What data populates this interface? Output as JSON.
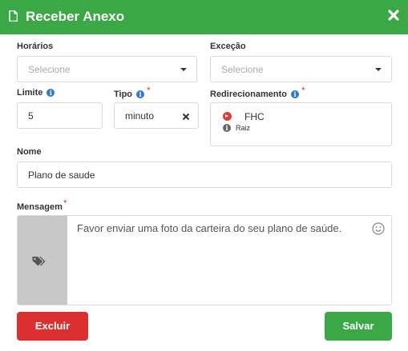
{
  "header": {
    "title": "Receber Anexo"
  },
  "fields": {
    "horarios": {
      "label": "Horários",
      "placeholder": "Selecione"
    },
    "excecao": {
      "label": "Exceção",
      "placeholder": "Selecione"
    },
    "limite": {
      "label": "Limite",
      "value": "5"
    },
    "tipo": {
      "label": "Tipo",
      "required": "*",
      "value": "minuto"
    },
    "redirecionamento": {
      "label": "Redirecionamento",
      "required": "*",
      "target": "FHC",
      "path": "Raiz"
    },
    "nome": {
      "label": "Nome",
      "value": "Plano de saude"
    },
    "mensagem": {
      "label": "Mensagem",
      "required": "*",
      "text": "Favor enviar uma foto da carteira do seu plano de saúde."
    }
  },
  "buttons": {
    "delete": "Excluir",
    "save": "Salvar"
  },
  "colors": {
    "header": "#3aa845",
    "delete": "#dc3030",
    "save": "#3aa845",
    "info": "#2f7ad0",
    "required": "#e53935"
  }
}
